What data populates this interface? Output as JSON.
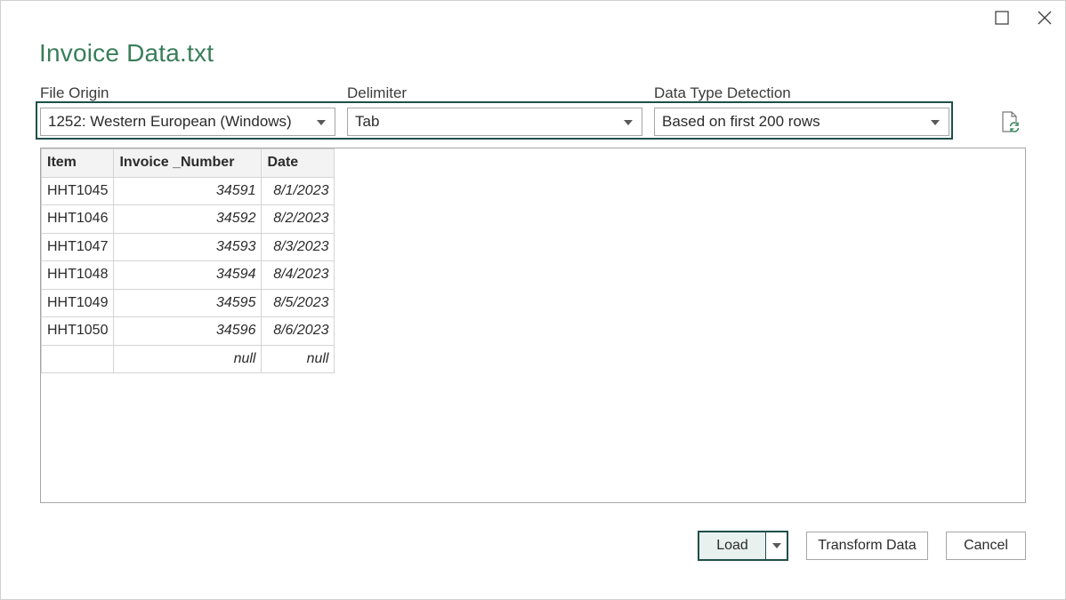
{
  "window": {
    "title": "Invoice Data.txt",
    "maximize_icon": "maximize-icon",
    "close_icon": "close-icon"
  },
  "file_origin": {
    "label": "File Origin",
    "value": "1252: Western European (Windows)"
  },
  "delimiter": {
    "label": "Delimiter",
    "value": "Tab"
  },
  "data_type_detection": {
    "label": "Data Type Detection",
    "value": "Based on first 200 rows"
  },
  "refresh_icon": "refresh-document-icon",
  "table": {
    "columns": [
      "Item",
      "Invoice _Number",
      "Date"
    ],
    "rows": [
      [
        "HHT1045",
        "34591",
        "8/1/2023"
      ],
      [
        "HHT1046",
        "34592",
        "8/2/2023"
      ],
      [
        "HHT1047",
        "34593",
        "8/3/2023"
      ],
      [
        "HHT1048",
        "34594",
        "8/4/2023"
      ],
      [
        "HHT1049",
        "34595",
        "8/5/2023"
      ],
      [
        "HHT1050",
        "34596",
        "8/6/2023"
      ],
      [
        "",
        "null",
        "null"
      ]
    ]
  },
  "buttons": {
    "load": "Load",
    "transform": "Transform Data",
    "cancel": "Cancel"
  },
  "colors": {
    "title": "#3a7d5a",
    "focus_border": "#1e4f4a",
    "load_bg": "#e8f1ee"
  }
}
